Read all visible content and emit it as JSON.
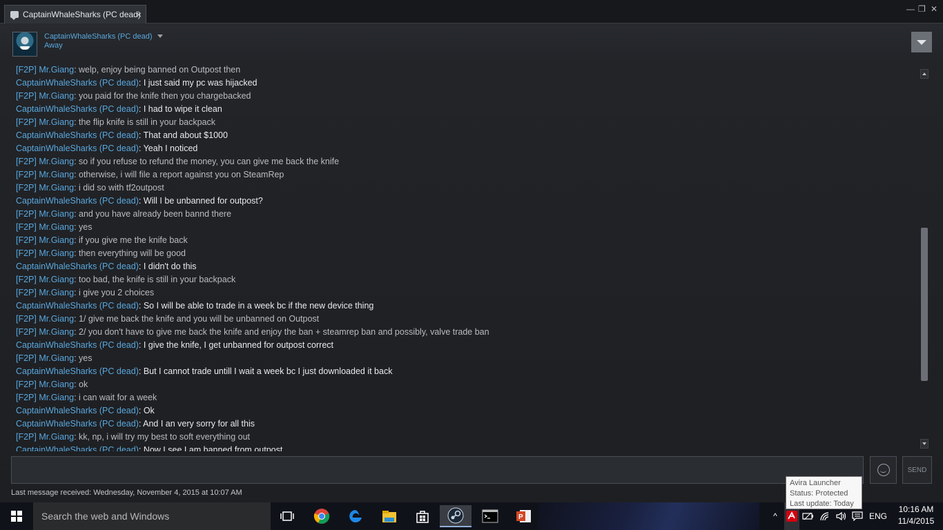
{
  "window": {
    "tab_title": "CaptainWhaleSharks (PC dead)",
    "tab_close": "×",
    "minimize": "—",
    "maximize": "❐",
    "close": "✕"
  },
  "header": {
    "username": "CaptainWhaleSharks (PC dead)",
    "status": "Away"
  },
  "messages": [
    {
      "sender": "[F2P] Mr.Giang",
      "text": ": welp, enjoy being banned on Outpost then",
      "me": false
    },
    {
      "sender": "CaptainWhaleSharks (PC dead)",
      "text": ": I just said my pc was hijacked",
      "me": true
    },
    {
      "sender": "[F2P] Mr.Giang",
      "text": ": you paid for the knife then you chargebacked",
      "me": false
    },
    {
      "sender": "CaptainWhaleSharks (PC dead)",
      "text": ": I had to wipe it clean",
      "me": true
    },
    {
      "sender": "[F2P] Mr.Giang",
      "text": ": the flip knife is still in your backpack",
      "me": false
    },
    {
      "sender": "CaptainWhaleSharks (PC dead)",
      "text": ": That and about $1000",
      "me": true
    },
    {
      "sender": "CaptainWhaleSharks (PC dead)",
      "text": ": Yeah I noticed",
      "me": true
    },
    {
      "sender": "[F2P] Mr.Giang",
      "text": ": so if you refuse to refund the money, you can give me back the knife",
      "me": false
    },
    {
      "sender": "[F2P] Mr.Giang",
      "text": ": otherwise, i will file a report against you on SteamRep",
      "me": false
    },
    {
      "sender": "[F2P] Mr.Giang",
      "text": ": i did so with tf2outpost",
      "me": false
    },
    {
      "sender": "CaptainWhaleSharks (PC dead)",
      "text": ": Will I be unbanned for outpost?",
      "me": true
    },
    {
      "sender": "[F2P] Mr.Giang",
      "text": ": and you have already been bannd there",
      "me": false
    },
    {
      "sender": "[F2P] Mr.Giang",
      "text": ": yes",
      "me": false
    },
    {
      "sender": "[F2P] Mr.Giang",
      "text": ": if you give me the knife back",
      "me": false
    },
    {
      "sender": "[F2P] Mr.Giang",
      "text": ": then everything will be good",
      "me": false
    },
    {
      "sender": "CaptainWhaleSharks (PC dead)",
      "text": ": I didn't do this",
      "me": true
    },
    {
      "sender": "[F2P] Mr.Giang",
      "text": ": too bad, the knife is still in your backpack",
      "me": false
    },
    {
      "sender": "[F2P] Mr.Giang",
      "text": ": i give you 2 choices",
      "me": false
    },
    {
      "sender": "CaptainWhaleSharks (PC dead)",
      "text": ": So I will be able to trade in a week bc if the new device thing",
      "me": true
    },
    {
      "sender": "[F2P] Mr.Giang",
      "text": ": 1/ give me back the knife and you will be unbanned on Outpost",
      "me": false
    },
    {
      "sender": "[F2P] Mr.Giang",
      "text": ": 2/ you don't have to give me back the knife and enjoy the ban + steamrep ban and possibly, valve trade ban",
      "me": false
    },
    {
      "sender": "CaptainWhaleSharks (PC dead)",
      "text": ": I give the knife, I get unbanned for outpost correct",
      "me": true
    },
    {
      "sender": "[F2P] Mr.Giang",
      "text": ": yes",
      "me": false
    },
    {
      "sender": "CaptainWhaleSharks (PC dead)",
      "text": ": But I cannot trade untill I wait a week bc I just downloaded it back",
      "me": true
    },
    {
      "sender": "[F2P] Mr.Giang",
      "text": ": ok",
      "me": false
    },
    {
      "sender": "[F2P] Mr.Giang",
      "text": ": i can wait for a week",
      "me": false
    },
    {
      "sender": "CaptainWhaleSharks (PC dead)",
      "text": ": Ok",
      "me": true
    },
    {
      "sender": "CaptainWhaleSharks (PC dead)",
      "text": ": And I an very sorry for all this",
      "me": true
    },
    {
      "sender": "[F2P] Mr.Giang",
      "text": ": kk, np, i will try my best to soft everything out",
      "me": false
    },
    {
      "sender": "CaptainWhaleSharks (PC dead)",
      "text": ": Now I see I am banned from outpost",
      "me": true
    }
  ],
  "composer": {
    "input_value": "",
    "send_label": "SEND",
    "last_message": "Last message received: Wednesday, November 4, 2015 at 10:07 AM"
  },
  "tooltip": {
    "line1": "Avira Launcher",
    "line2": "Status: Protected",
    "line3": "Last update: Today"
  },
  "taskbar": {
    "search_placeholder": "Search the web and Windows",
    "apps": [
      "task-view-icon",
      "chrome-icon",
      "edge-icon",
      "file-explorer-icon",
      "store-icon",
      "steam-icon",
      "cmd-icon",
      "powerpoint-icon"
    ],
    "tray_up": "^",
    "language": "ENG",
    "time": "10:16 AM",
    "date": "11/4/2015"
  }
}
